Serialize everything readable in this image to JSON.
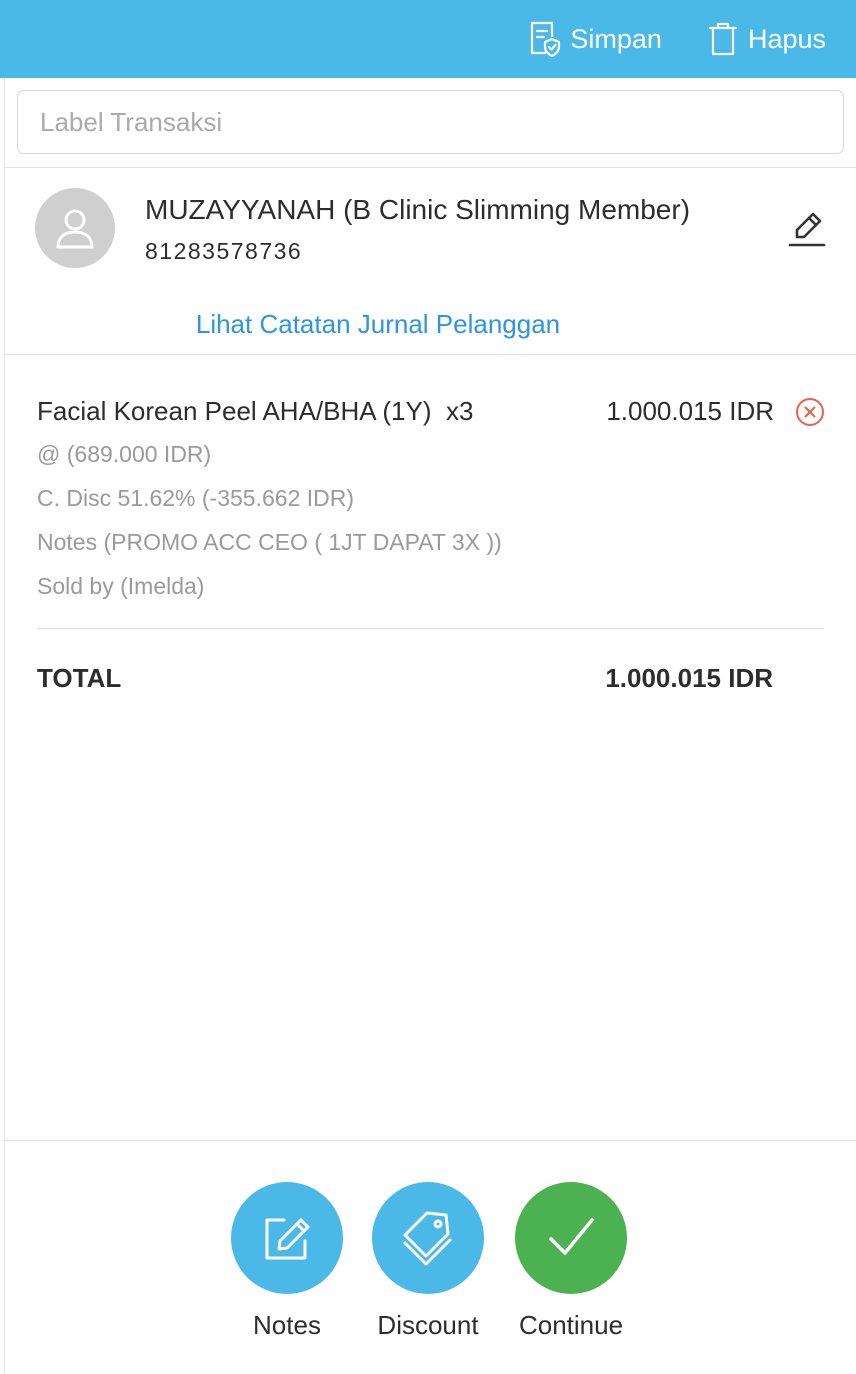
{
  "header": {
    "save_label": "Simpan",
    "delete_label": "Hapus",
    "background_color": "#4ab9e8"
  },
  "transaction_label": {
    "placeholder": "Label Transaksi",
    "value": ""
  },
  "customer": {
    "name": "MUZAYYANAH (B Clinic Slimming Member)",
    "phone": "81283578736",
    "journal_link": "Lihat Catatan Jurnal Pelanggan",
    "avatar_icon": "user-icon",
    "edit_icon": "pencil-icon"
  },
  "items": [
    {
      "name": "Facial Korean Peel AHA/BHA (1Y)",
      "quantity": "x3",
      "price": "1.000.015 IDR",
      "unit_price": "@ (689.000 IDR)",
      "discount": "C. Disc 51.62% (-355.662 IDR)",
      "notes": "Notes (PROMO ACC CEO ( 1JT DAPAT 3X ))",
      "sold_by": "Sold by (Imelda)",
      "remove_icon": "close-circle-icon"
    }
  ],
  "summary": {
    "total_label": "TOTAL",
    "total_value": "1.000.015 IDR"
  },
  "actions": {
    "notes_label": "Notes",
    "discount_label": "Discount",
    "continue_label": "Continue",
    "notes_color": "#4ab9e8",
    "discount_color": "#4ab9e8",
    "continue_color": "#4cb150"
  },
  "colors": {
    "link": "#2e95e0",
    "remove": "#e8624c",
    "muted_text": "#9a9a9a"
  }
}
